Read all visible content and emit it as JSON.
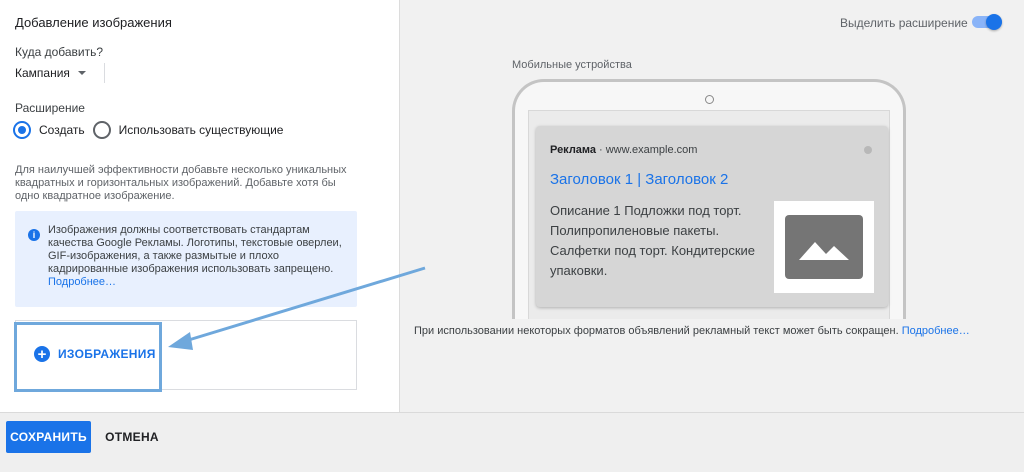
{
  "form": {
    "title": "Добавление изображения",
    "where_label": "Куда добавить?",
    "where_value": "Кампания",
    "extension_label": "Расширение",
    "radio_create": "Создать",
    "radio_existing": "Использовать существующие",
    "hint": "Для наилучшей эффективности добавьте несколько уникальных квадратных и горизонтальных изображений. Добавьте хотя бы одно квадратное изображение.",
    "info_text": "Изображения должны соответствовать стандартам качества Google Рекламы. Логотипы, текстовые оверлеи, GIF-изображения, а также размытые и плохо кадрированные изображения использовать запрещено.",
    "info_link": "Подробнее…",
    "add_images_label": "ИЗОБРАЖЕНИЯ"
  },
  "preview": {
    "toggle_label": "Выделить расширение",
    "toggle_on": true,
    "device_label": "Мобильные устройства",
    "ad_badge": "Реклама",
    "ad_url": "· www.example.com",
    "ad_headline": "Заголовок 1 | Заголовок 2",
    "ad_description": "Описание 1 Подложки под торт. Полипропиленовые пакеты. Салфетки под торт. Кондитерские упаковки.",
    "note": "При использовании некоторых форматов объявлений рекламный текст может быть сокращен.",
    "note_link": "Подробнее…"
  },
  "footer": {
    "save_label": "СОХРАНИТЬ",
    "cancel_label": "ОТМЕНА"
  },
  "colors": {
    "accent": "#1a73e8",
    "info_bg": "#e8f0fe",
    "annotation_arrow": "#6fa8dc"
  }
}
